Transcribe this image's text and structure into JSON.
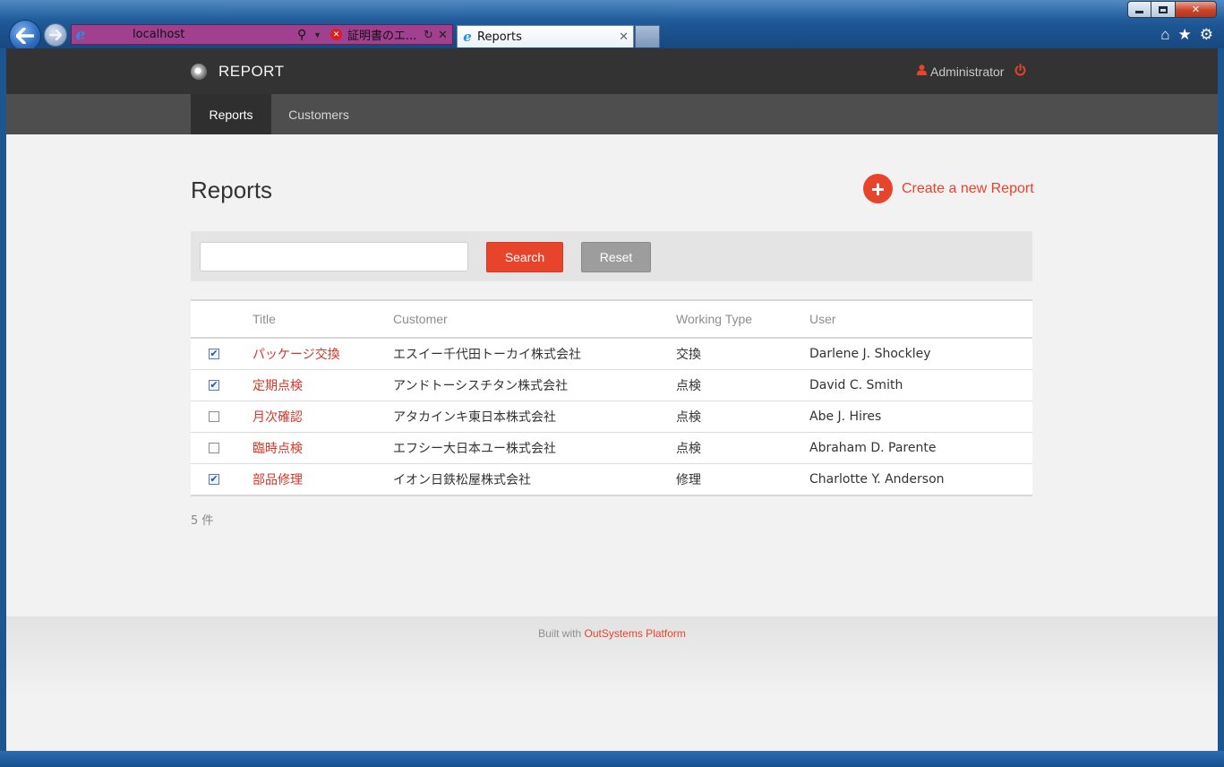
{
  "browser": {
    "address_url": "localhost",
    "cert_error_text": "証明書のエ...",
    "tab_title": "Reports"
  },
  "app": {
    "brand": "REPORT",
    "user_name": "Administrator"
  },
  "menu": {
    "items": [
      {
        "label": "Reports",
        "active": true
      },
      {
        "label": "Customers",
        "active": false
      }
    ]
  },
  "page": {
    "title": "Reports",
    "create_label": "Create a new Report"
  },
  "search": {
    "value": "",
    "placeholder": "",
    "search_label": "Search",
    "reset_label": "Reset"
  },
  "table": {
    "headers": {
      "title": "Title",
      "customer": "Customer",
      "working_type": "Working Type",
      "user": "User"
    },
    "rows": [
      {
        "checked": true,
        "title": "パッケージ交換",
        "customer": "エスイー千代田トーカイ株式会社",
        "working_type": "交換",
        "user": "Darlene J. Shockley"
      },
      {
        "checked": true,
        "title": "定期点検",
        "customer": "アンドトーシスチタン株式会社",
        "working_type": "点検",
        "user": "David C. Smith"
      },
      {
        "checked": false,
        "title": "月次確認",
        "customer": "アタカインキ東日本株式会社",
        "working_type": "点検",
        "user": "Abe J. Hires"
      },
      {
        "checked": false,
        "title": "臨時点検",
        "customer": "エフシー大日本ユー株式会社",
        "working_type": "点検",
        "user": "Abraham D. Parente"
      },
      {
        "checked": true,
        "title": "部品修理",
        "customer": "イオン日鉄松屋株式会社",
        "working_type": "修理",
        "user": "Charlotte Y. Anderson"
      }
    ]
  },
  "record_count": "5 件",
  "footer": {
    "prefix": "Built with",
    "link": "OutSystems Platform"
  },
  "colors": {
    "accent": "#e8432b",
    "topbar": "#333333",
    "menubar": "#4e4e4e"
  }
}
